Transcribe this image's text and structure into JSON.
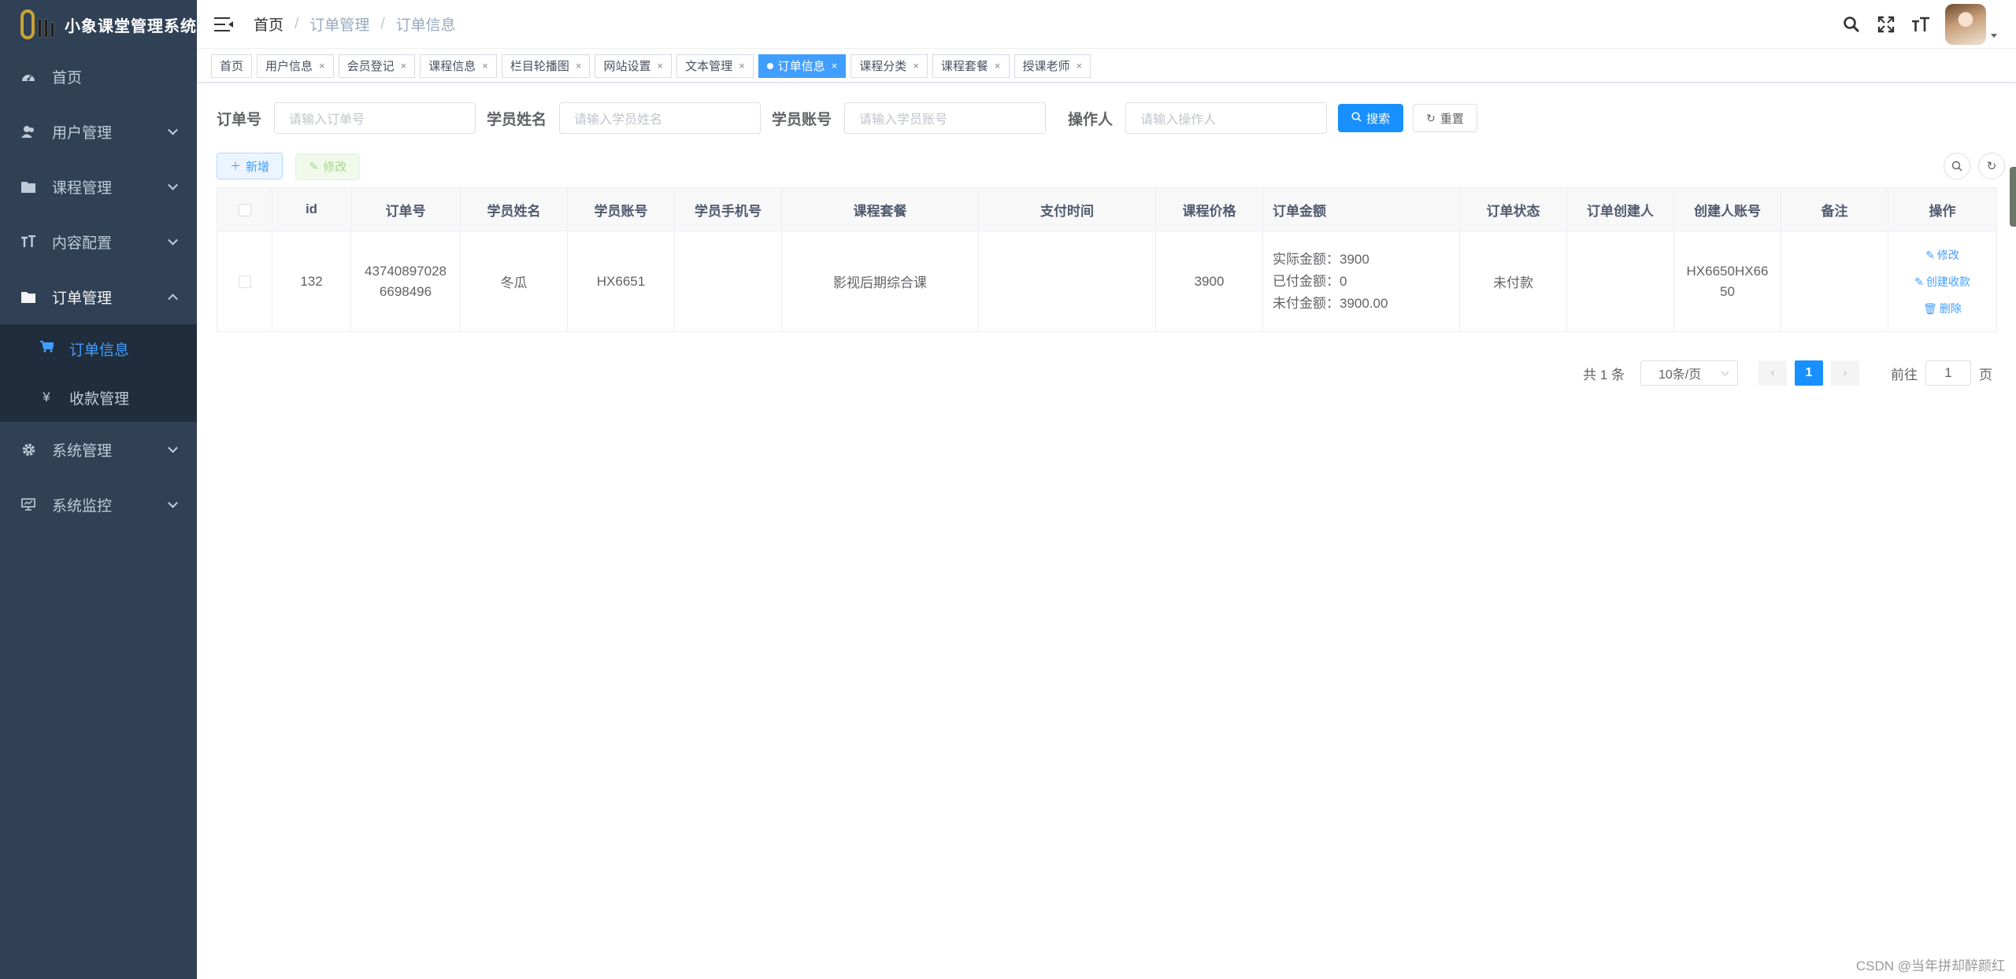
{
  "app": {
    "title": "小象课堂管理系统"
  },
  "sidebar": {
    "items": [
      {
        "label": "首页",
        "icon": "dashboard-icon"
      },
      {
        "label": "用户管理",
        "icon": "user-icon",
        "expandable": true
      },
      {
        "label": "课程管理",
        "icon": "folder-icon",
        "expandable": true
      },
      {
        "label": "内容配置",
        "icon": "text-icon",
        "expandable": true
      },
      {
        "label": "订单管理",
        "icon": "folder-icon",
        "expandable": true,
        "open": true
      },
      {
        "label": "系统管理",
        "icon": "gear-icon",
        "expandable": true
      },
      {
        "label": "系统监控",
        "icon": "monitor-icon",
        "expandable": true
      }
    ],
    "submenu": [
      {
        "label": "订单信息",
        "icon": "cart-icon",
        "active": true
      },
      {
        "label": "收款管理",
        "icon": "yen-icon"
      }
    ]
  },
  "breadcrumb": [
    "首页",
    "订单管理",
    "订单信息"
  ],
  "tags": [
    "首页",
    "用户信息",
    "会员登记",
    "课程信息",
    "栏目轮播图",
    "网站设置",
    "文本管理",
    "订单信息",
    "课程分类",
    "课程套餐",
    "授课老师"
  ],
  "tags_active": "订单信息",
  "search": {
    "order_no": {
      "label": "订单号",
      "placeholder": "请输入订单号"
    },
    "student_name": {
      "label": "学员姓名",
      "placeholder": "请输入学员姓名"
    },
    "student_account": {
      "label": "学员账号",
      "placeholder": "请输入学员账号"
    },
    "operator": {
      "label": "操作人",
      "placeholder": "请输入操作人"
    },
    "search_btn": "搜索",
    "reset_btn": "重置"
  },
  "toolbar": {
    "add": "新增",
    "edit": "修改"
  },
  "table": {
    "columns": [
      "id",
      "订单号",
      "学员姓名",
      "学员账号",
      "学员手机号",
      "课程套餐",
      "支付时间",
      "课程价格",
      "订单金额",
      "订单状态",
      "订单创建人",
      "创建人账号",
      "备注",
      "操作"
    ],
    "rows": [
      {
        "id": "132",
        "order_no_1": "43740897028",
        "order_no_2": "6698496",
        "student_name": "冬瓜",
        "student_account": "HX6651",
        "student_phone": "",
        "package": "影视后期综合课",
        "pay_time": "",
        "price": "3900",
        "amount_actual": "实际金额：3900",
        "amount_paid": "已付金额：0",
        "amount_unpaid": "未付金额：3900.00",
        "status": "未付款",
        "creator": "",
        "creator_account_1": "HX6650HX66",
        "creator_account_2": "50",
        "remark": "",
        "op_edit": "修改",
        "op_receipt": "创建收款",
        "op_delete": "删除"
      }
    ]
  },
  "pagination": {
    "total": "共 1 条",
    "page_size": "10条/页",
    "current": "1",
    "goto_prefix": "前往",
    "goto_value": "1",
    "goto_suffix": "页"
  },
  "watermark": "CSDN @当年拼却醉颜红",
  "colors": {
    "sidebar_bg": "#304156",
    "submenu_bg": "#1f2d3d",
    "primary": "#1890ff",
    "active_link": "#409eff"
  }
}
